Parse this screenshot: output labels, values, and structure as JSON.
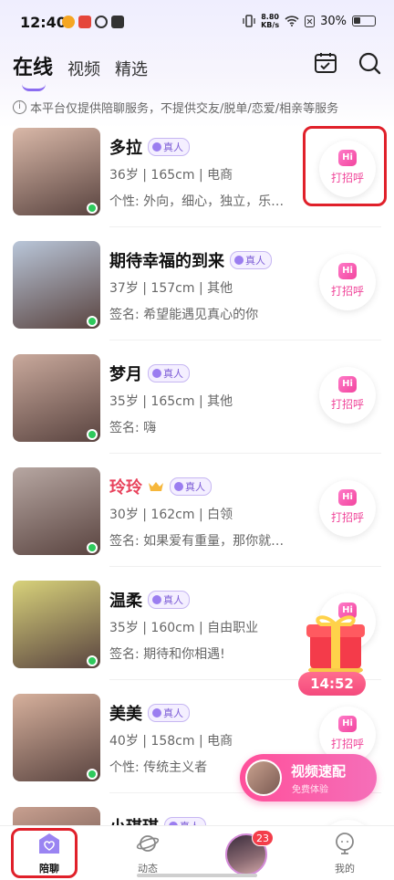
{
  "status_bar": {
    "time": "12:40",
    "net_speed_value": "8.80",
    "net_speed_unit": "KB/s",
    "battery": "30%"
  },
  "header": {
    "tabs": [
      "在线",
      "视频",
      "精选"
    ],
    "active_tab": 0,
    "calendar_icon": "calendar-check-icon",
    "search_icon": "search-icon"
  },
  "notice": "本平台仅提供陪聊服务，不提供交友/脱单/恋爱/相亲等服务",
  "verified_label": "真人",
  "hi_button": {
    "bubble": "Hi",
    "label": "打招呼"
  },
  "users": [
    {
      "name": "多拉",
      "vip": false,
      "meta": "36岁 | 165cm | 电商",
      "sig": "个性: 外向，细心，独立，乐…",
      "avatar_color": "#d9b8a8"
    },
    {
      "name": "期待幸福的到来",
      "vip": false,
      "meta": "37岁 | 157cm | 其他",
      "sig": "签名: 希望能遇见真心的你",
      "avatar_color": "#b9c6d9"
    },
    {
      "name": "梦月",
      "vip": false,
      "meta": "35岁 | 165cm | 其他",
      "sig": "签名: 嗨",
      "avatar_color": "#c9a99c"
    },
    {
      "name": "玲玲",
      "vip": true,
      "meta": "30岁 | 162cm | 白领",
      "sig": "签名: 如果爱有重量，那你就…",
      "avatar_color": "#b7a7a2"
    },
    {
      "name": "温柔",
      "vip": false,
      "meta": "35岁 | 160cm | 自由职业",
      "sig": "签名: 期待和你相遇!",
      "avatar_color": "#d8d27a"
    },
    {
      "name": "美美",
      "vip": false,
      "meta": "40岁 | 158cm | 电商",
      "sig": "个性: 传统主义者",
      "avatar_color": "#d6b09c"
    },
    {
      "name": "小琪琪",
      "vip": false,
      "meta": "",
      "sig": "",
      "avatar_color": "#c8a090"
    }
  ],
  "floating_gift": {
    "timer": "14:52"
  },
  "video_match": {
    "title": "视频速配",
    "subtitle": "免费体验"
  },
  "bottom_nav": {
    "items": [
      "陪聊",
      "动态",
      "",
      "我的"
    ],
    "active": 0,
    "badge": "23"
  },
  "colors": {
    "accent": "#8b6cf0",
    "hi_pink": "#f0469a",
    "online": "#2ec95c",
    "highlight": "#e0202a"
  }
}
